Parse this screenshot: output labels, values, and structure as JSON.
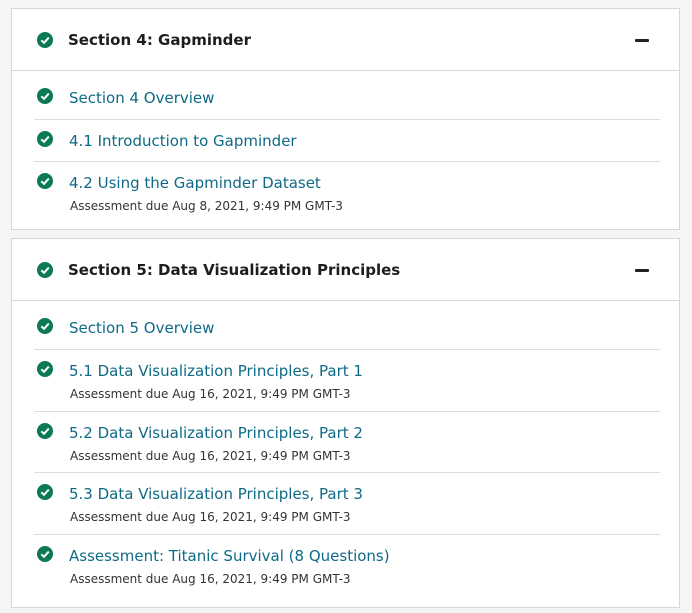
{
  "colors": {
    "check": "#0b7a52",
    "link": "#0e6a86",
    "title": "#1d1d1d",
    "border": "#d7d7d7"
  },
  "icons": {
    "complete": "check-circle-icon",
    "collapse": "minus-icon"
  },
  "sections": [
    {
      "title": "Section 4: Gapminder",
      "items": [
        {
          "label": "Section 4 Overview",
          "meta": ""
        },
        {
          "label": "4.1 Introduction to Gapminder",
          "meta": ""
        },
        {
          "label": "4.2 Using the Gapminder Dataset",
          "meta": "Assessment due Aug 8, 2021, 9:49 PM GMT-3"
        }
      ]
    },
    {
      "title": "Section 5: Data Visualization Principles",
      "items": [
        {
          "label": "Section 5 Overview",
          "meta": ""
        },
        {
          "label": "5.1 Data Visualization Principles, Part 1",
          "meta": "Assessment due Aug 16, 2021, 9:49 PM GMT-3"
        },
        {
          "label": "5.2 Data Visualization Principles, Part 2",
          "meta": "Assessment due Aug 16, 2021, 9:49 PM GMT-3"
        },
        {
          "label": "5.3 Data Visualization Principles, Part 3",
          "meta": "Assessment due Aug 16, 2021, 9:49 PM GMT-3"
        },
        {
          "label": "Assessment: Titanic Survival (8 Questions)",
          "meta": "Assessment due Aug 16, 2021, 9:49 PM GMT-3"
        }
      ]
    }
  ]
}
